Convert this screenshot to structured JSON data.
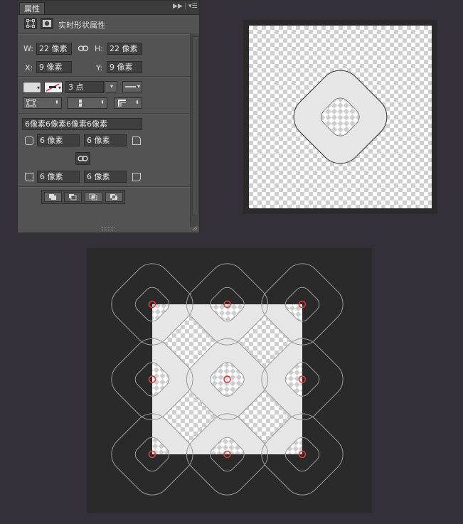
{
  "panel": {
    "tab_title": "属性",
    "header_title": "实时形状属性",
    "w_label": "W:",
    "w_value": "22 像素",
    "h_label": "H:",
    "h_value": "22 像素",
    "x_label": "X:",
    "x_value": "9 像素",
    "y_label": "Y:",
    "y_value": "9 像素",
    "stroke_width": "3 点",
    "corner_summary": "6像素6像素6像素6像素",
    "corner_tl": "6 像素",
    "corner_tr": "6 像素",
    "corner_bl": "6 像素",
    "corner_br": "6 像素"
  },
  "colors": {
    "canvas_bg": "#34303a",
    "panel_bg": "#535353",
    "marker_red": "#e23a3a",
    "shape_fill": "#e6e6e6"
  }
}
